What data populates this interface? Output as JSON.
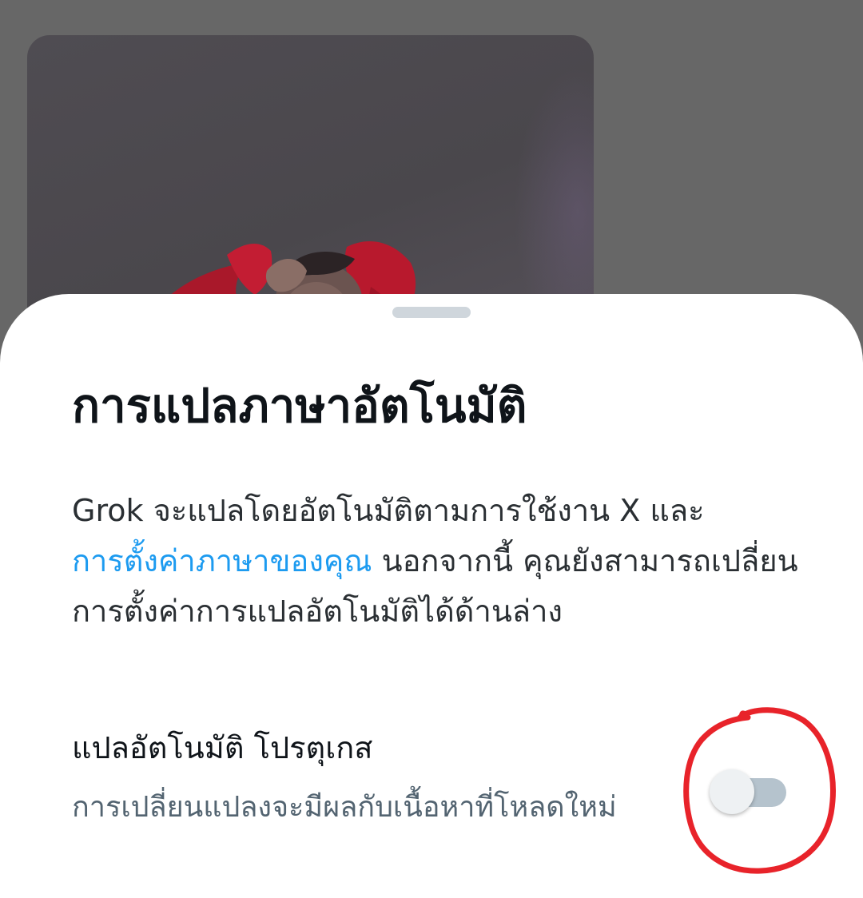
{
  "sheet": {
    "title": "การแปลภาษาอัตโนมัติ",
    "description": {
      "part1": "Grok จะแปลโดยอัตโนมัติตามการใช้งาน X และ",
      "link": "การตั้งค่าภาษาของคุณ",
      "part2": " นอกจากนี้ คุณยังสามารถเปลี่ยนการตั้งค่าการแปลอัตโนมัติได้ด้านล่าง"
    },
    "setting": {
      "label": "แปลอัตโนมัติ โปรตุเกส",
      "sublabel": "การเปลี่ยนแปลงจะมีผลกับเนื้อหาที่โหลดใหม่",
      "enabled": false
    }
  },
  "colors": {
    "accent_link": "#1d9bf0",
    "title_text": "#0f1419",
    "secondary_text": "#536471",
    "toggle_track_off": "#b5c3cd",
    "annotation_circle": "#e8232a",
    "overlay_background": "#676767"
  },
  "icons": {
    "sheet_handle": "drag-handle-icon",
    "annotation": "red-circle-annotation-icon"
  }
}
